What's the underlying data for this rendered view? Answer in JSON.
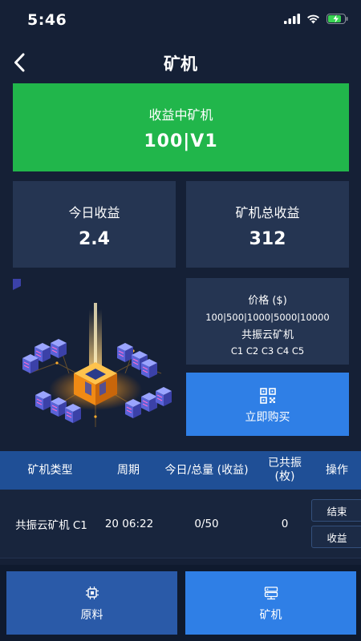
{
  "status_bar": {
    "time": "5:46"
  },
  "nav": {
    "title": "矿机"
  },
  "mining_card": {
    "label": "收益中矿机",
    "value": "100|V1"
  },
  "stats": {
    "today": {
      "label": "今日收益",
      "value": "2.4"
    },
    "total": {
      "label": "矿机总收益",
      "value": "312"
    }
  },
  "price_card": {
    "label": "价格 ($)",
    "options": "100|500|1000|5000|10000",
    "type": "共振云矿机",
    "codes": "C1 C2 C3 C4 C5"
  },
  "buy_button": {
    "label": "立即购买",
    "icon": "qr-code-icon"
  },
  "table": {
    "headers": [
      "矿机类型",
      "周期",
      "今日/总量 (收益)",
      "已共振",
      "(枚)",
      "操作"
    ],
    "rows": [
      {
        "type": "共振云矿机 C1",
        "period": "20 06:22",
        "today_total": "0/50",
        "resonated": "0",
        "actions": [
          "结束",
          "收益"
        ]
      }
    ]
  },
  "bottom_nav": [
    {
      "label": "原料",
      "icon": "chip-icon"
    },
    {
      "label": "矿机",
      "icon": "server-icon"
    }
  ],
  "colors": {
    "background": "#152036",
    "card": "#253552",
    "green": "#21b64b",
    "blue": "#2f7fe6",
    "table_header": "#1f4f96"
  }
}
